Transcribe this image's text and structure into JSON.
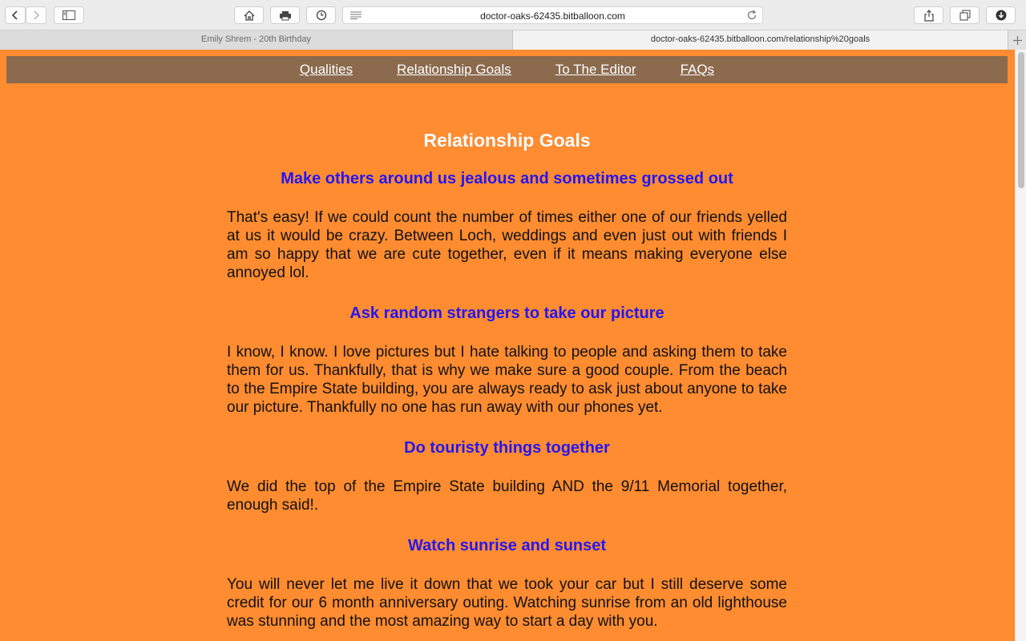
{
  "browser": {
    "url": "doctor-oaks-62435.bitballoon.com",
    "tabs": [
      {
        "label": "Emily Shrem - 20th Birthday"
      },
      {
        "label": "doctor-oaks-62435.bitballoon.com/relationship%20goals"
      }
    ]
  },
  "nav": {
    "items": [
      {
        "label": "Qualities"
      },
      {
        "label": "Relationship Goals"
      },
      {
        "label": "To The Editor"
      },
      {
        "label": "FAQs"
      }
    ]
  },
  "page": {
    "title": "Relationship Goals",
    "sections": [
      {
        "heading": "Make others around us jealous and sometimes grossed out",
        "body": "That's easy! If we could count the number of times either one of our friends yelled at us it would be crazy. Between Loch, weddings and even just out with friends I am so happy that we are cute together, even if it means making everyone else annoyed lol."
      },
      {
        "heading": "Ask random strangers to take our picture",
        "body": "I know, I know. I love pictures but I hate talking to people and asking them to take them for us. Thankfully, that is why we make sure a good couple. From the beach to the Empire State building, you are always ready to ask just about anyone to take our picture. Thankfully no one has run away with our phones yet."
      },
      {
        "heading": "Do touristy things together",
        "body": "We did the top of the Empire State building AND the 9/11 Memorial together, enough said!."
      },
      {
        "heading": "Watch sunrise and sunset",
        "body": "You will never let me live it down that we took your car but I still deserve some credit for our 6 month anniversary outing. Watching sunrise from an old lighthouse was stunning and the most amazing way to start a day with you."
      }
    ]
  },
  "colors": {
    "page_background": "#ff8c30",
    "nav_background": "#8b6a4e",
    "heading": "#2516f0",
    "title": "#ffffff"
  }
}
